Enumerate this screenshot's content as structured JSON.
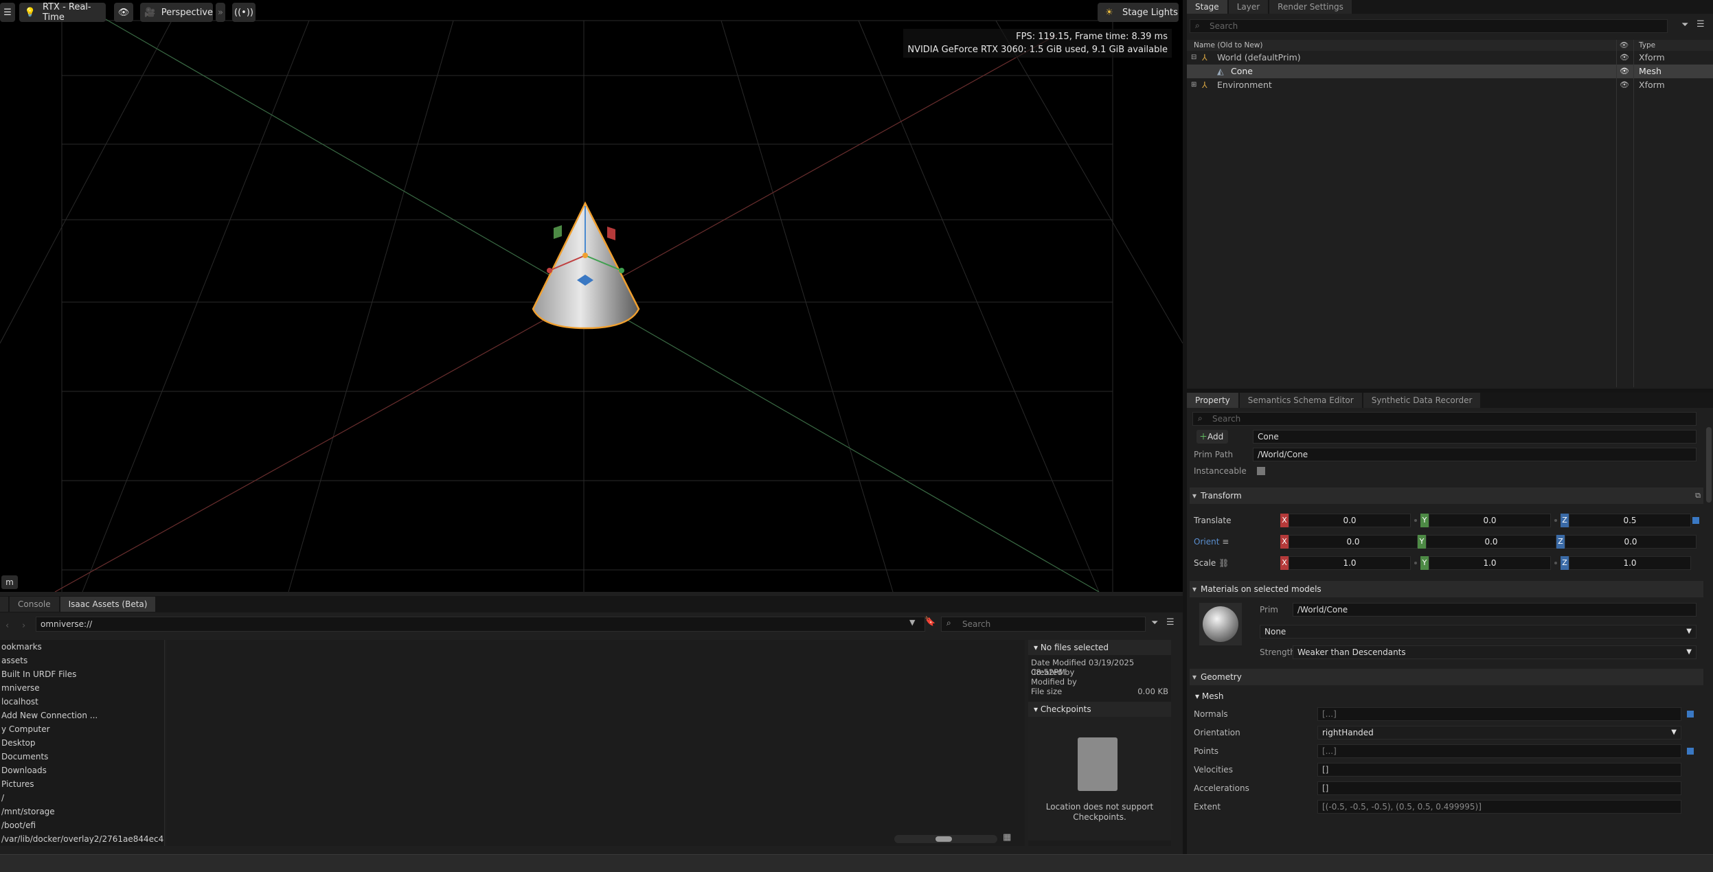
{
  "viewport": {
    "renderer_label": "RTX - Real-Time",
    "camera_label": "Perspective",
    "stage_lights_label": "Stage Lights",
    "fps_line": "FPS: 119.15, Frame time: 8.39 ms",
    "gpu_line": "NVIDIA GeForce RTX 3060: 1.5 GiB used, 9.1 GiB available",
    "corner_badge": "m"
  },
  "bottom_panel": {
    "tabs": [
      "Console",
      "Isaac Assets (Beta)"
    ],
    "path": "omniverse://",
    "search_placeholder": "Search",
    "tree": [
      "ookmarks",
      "assets",
      "Built In URDF Files",
      "mniverse",
      "localhost",
      "Add New Connection ...",
      "y Computer",
      "Desktop",
      "Documents",
      "Downloads",
      "Pictures",
      "/",
      "/mnt/storage",
      "/boot/efi",
      "/var/lib/docker/overlay2/2761ae844ec4!"
    ],
    "info": {
      "title": "No files selected",
      "date_modified_label": "Date Modified",
      "date_modified_value": "03/19/2025 08:52PM",
      "created_by_label": "Created by",
      "modified_by_label": "Modified by",
      "file_size_label": "File size",
      "file_size_value": "0.00 KB",
      "checkpoints_title": "Checkpoints",
      "checkpoints_msg_1": "Location does not support",
      "checkpoints_msg_2": "Checkpoints."
    }
  },
  "stage": {
    "tabs": [
      "Stage",
      "Layer",
      "Render Settings"
    ],
    "search_placeholder": "Search",
    "col_name": "Name (Old to New)",
    "col_type": "Type",
    "rows": [
      {
        "name": "World (defaultPrim)",
        "type": "Xform"
      },
      {
        "name": "Cone",
        "type": "Mesh"
      },
      {
        "name": "Environment",
        "type": "Xform"
      }
    ]
  },
  "property": {
    "tabs": [
      "Property",
      "Semantics Schema Editor",
      "Synthetic Data Recorder"
    ],
    "search_placeholder": "Search",
    "add_label": "Add",
    "name_value": "Cone",
    "prim_path_label": "Prim Path",
    "prim_path_value": "/World/Cone",
    "instanceable_label": "Instanceable",
    "transform_title": "Transform",
    "translate_label": "Translate",
    "orient_label": "Orient",
    "scale_label": "Scale",
    "translate": [
      "0.0",
      "0.0",
      "0.5"
    ],
    "orient": [
      "0.0",
      "0.0",
      "0.0"
    ],
    "scale": [
      "1.0",
      "1.0",
      "1.0"
    ],
    "axis_x": "X",
    "axis_y": "Y",
    "axis_z": "Z",
    "materials_title": "Materials on selected models",
    "prim_label": "Prim",
    "prim_value": "/World/Cone",
    "material_value": "None",
    "strength_label": "Strength",
    "strength_value": "Weaker than Descendants",
    "geometry_title": "Geometry",
    "mesh_title": "Mesh",
    "normals_label": "Normals",
    "normals_value": "[...]",
    "orientation_label": "Orientation",
    "orientation_value": "rightHanded",
    "points_label": "Points",
    "points_value": "[...]",
    "velocities_label": "Velocities",
    "velocities_value": "[]",
    "accelerations_label": "Accelerations",
    "accelerations_value": "[]",
    "extent_label": "Extent",
    "extent_value": "[(-0.5, -0.5, -0.5), (0.5, 0.5, 0.499995)]"
  }
}
